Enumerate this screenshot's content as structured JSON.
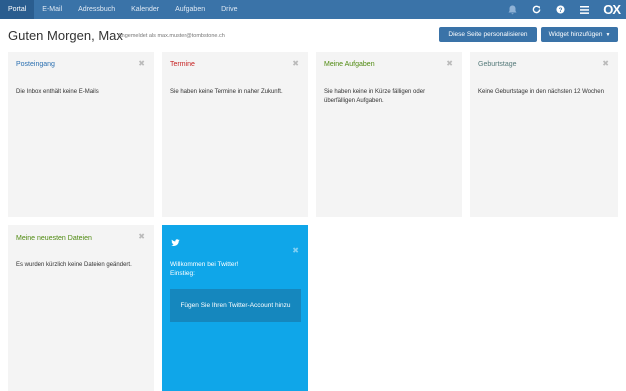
{
  "topbar": {
    "tabs": [
      {
        "label": "Portal",
        "active": true
      },
      {
        "label": "E-Mail",
        "active": false
      },
      {
        "label": "Adressbuch",
        "active": false
      },
      {
        "label": "Kalender",
        "active": false
      },
      {
        "label": "Aufgaben",
        "active": false
      },
      {
        "label": "Drive",
        "active": false
      }
    ],
    "icons": [
      "bell-icon",
      "refresh-icon",
      "help-icon",
      "menu-icon"
    ],
    "logo": "OX"
  },
  "header": {
    "greeting": "Guten Morgen, Max",
    "signed_in": "Angemeldet als max.muster@tombstone.ch",
    "personalize_label": "Diese Seite personalisieren",
    "add_widget_label": "Widget hinzufügen"
  },
  "widgets": [
    {
      "title": "Posteingang",
      "body": "Die Inbox enthält keine E-Mails",
      "color": "#2a6fb0"
    },
    {
      "title": "Termine",
      "body": "Sie haben keine Termine in naher Zukunft.",
      "color": "#c51f1f"
    },
    {
      "title": "Meine Aufgaben",
      "body": "Sie haben keine in Kürze fälligen oder überfälligen Aufgaben.",
      "color": "#4f8a10"
    },
    {
      "title": "Geburtstage",
      "body": "Keine Geburtstage in den nächsten 12 Wochen",
      "color": "#557a7a"
    },
    {
      "title": "Meine neuesten Dateien",
      "body": "Es wurden kürzlich keine Dateien geändert.",
      "color": "#4f8a10"
    }
  ],
  "twitter": {
    "welcome": "Willkommen bei Twitter!",
    "intro": "Einstieg:",
    "button_label": "Fügen Sie Ihren Twitter-Account hinzu",
    "bg_color": "#0fa6e9"
  }
}
